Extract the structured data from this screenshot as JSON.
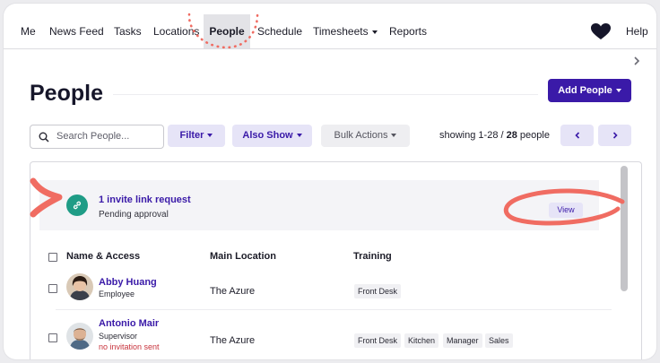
{
  "nav": {
    "items": [
      "Me",
      "News Feed",
      "Tasks",
      "Locations",
      "People",
      "Schedule",
      "Timesheets",
      "Reports"
    ],
    "active": "People",
    "help": "Help"
  },
  "page": {
    "title": "People",
    "add_button": "Add People"
  },
  "toolbar": {
    "search_placeholder": "Search People...",
    "filter": "Filter",
    "also_show": "Also Show",
    "bulk_actions": "Bulk Actions",
    "showing_prefix": "showing 1-28 / ",
    "showing_total": "28",
    "showing_suffix": " people"
  },
  "invite": {
    "title": "1 invite link request",
    "subtitle": "Pending approval",
    "view_button": "View"
  },
  "table": {
    "headers": [
      "Name & Access",
      "Main Location",
      "Training"
    ],
    "rows": [
      {
        "name": "Abby Huang",
        "role": "Employee",
        "location": "The Azure",
        "training": [
          "Front Desk"
        ]
      },
      {
        "name": "Antonio Mair",
        "role": "Supervisor",
        "warning": "no invitation sent",
        "location": "The Azure",
        "training": [
          "Front Desk",
          "Kitchen",
          "Manager",
          "Sales"
        ]
      }
    ]
  },
  "colors": {
    "brand_purple": "#3a1aa8",
    "teal": "#1f9c86",
    "annotation_coral": "#f06c62"
  }
}
